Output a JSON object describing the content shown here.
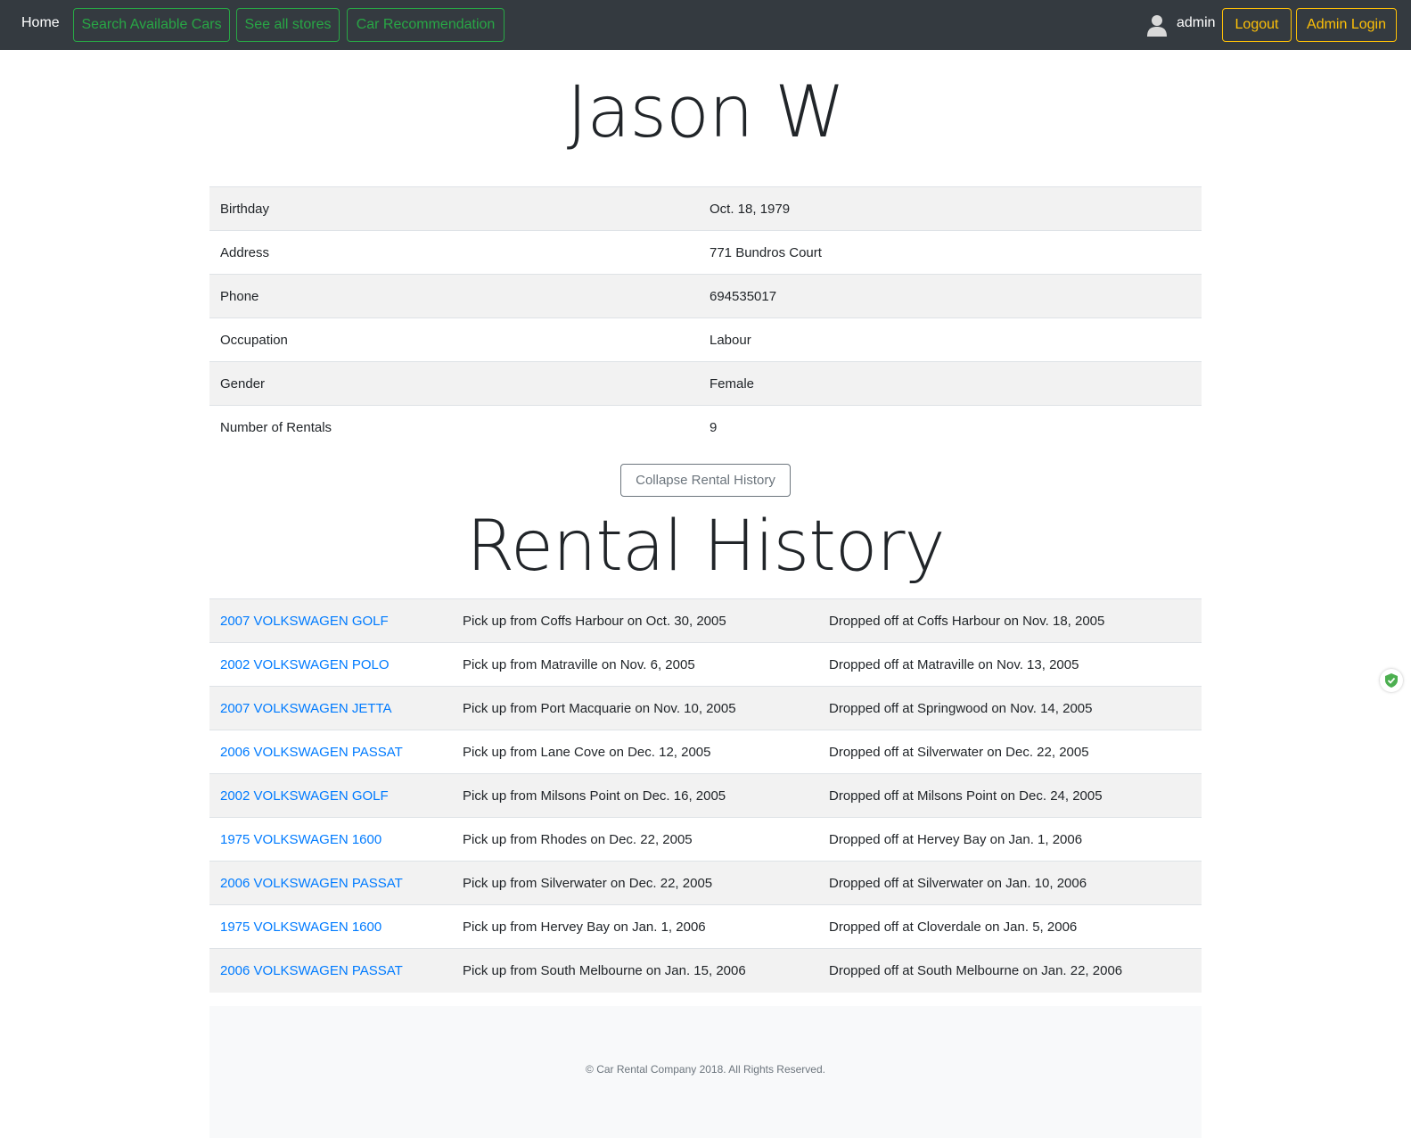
{
  "nav": {
    "home": "Home",
    "search": "Search Available Cars",
    "stores": "See all stores",
    "recommend": "Car Recommendation",
    "user": "admin",
    "logout": "Logout",
    "admin_login": "Admin Login"
  },
  "customer": {
    "name": "Jason W",
    "details": [
      {
        "label": "Birthday",
        "value": "Oct. 18, 1979"
      },
      {
        "label": "Address",
        "value": "771 Bundros Court"
      },
      {
        "label": "Phone",
        "value": "694535017"
      },
      {
        "label": "Occupation",
        "value": "Labour"
      },
      {
        "label": "Gender",
        "value": "Female"
      },
      {
        "label": "Number of Rentals",
        "value": "9"
      }
    ]
  },
  "collapse_button": "Collapse Rental History",
  "history": {
    "title": "Rental History",
    "rows": [
      {
        "car": "2007 VOLKSWAGEN GOLF",
        "pickup": "Pick up from Coffs Harbour on Oct. 30, 2005",
        "dropoff": "Dropped off at Coffs Harbour on Nov. 18, 2005"
      },
      {
        "car": "2002 VOLKSWAGEN POLO",
        "pickup": "Pick up from Matraville on Nov. 6, 2005",
        "dropoff": "Dropped off at Matraville on Nov. 13, 2005"
      },
      {
        "car": "2007 VOLKSWAGEN JETTA",
        "pickup": "Pick up from Port Macquarie on Nov. 10, 2005",
        "dropoff": "Dropped off at Springwood on Nov. 14, 2005"
      },
      {
        "car": "2006 VOLKSWAGEN PASSAT",
        "pickup": "Pick up from Lane Cove on Dec. 12, 2005",
        "dropoff": "Dropped off at Silverwater on Dec. 22, 2005"
      },
      {
        "car": "2002 VOLKSWAGEN GOLF",
        "pickup": "Pick up from Milsons Point on Dec. 16, 2005",
        "dropoff": "Dropped off at Milsons Point on Dec. 24, 2005"
      },
      {
        "car": "1975 VOLKSWAGEN 1600",
        "pickup": "Pick up from Rhodes on Dec. 22, 2005",
        "dropoff": "Dropped off at Hervey Bay on Jan. 1, 2006"
      },
      {
        "car": "2006 VOLKSWAGEN PASSAT",
        "pickup": "Pick up from Silverwater on Dec. 22, 2005",
        "dropoff": "Dropped off at Silverwater on Jan. 10, 2006"
      },
      {
        "car": "1975 VOLKSWAGEN 1600",
        "pickup": "Pick up from Hervey Bay on Jan. 1, 2006",
        "dropoff": "Dropped off at Cloverdale on Jan. 5, 2006"
      },
      {
        "car": "2006 VOLKSWAGEN PASSAT",
        "pickup": "Pick up from South Melbourne on Jan. 15, 2006",
        "dropoff": "Dropped off at South Melbourne on Jan. 22, 2006"
      }
    ]
  },
  "footer": "© Car Rental Company 2018. All Rights Reserved.",
  "icons": {
    "user": "user-icon",
    "shield": "shield-check-icon"
  },
  "colors": {
    "navbar_bg": "#343a40",
    "success": "#28a745",
    "warning": "#ffc107",
    "link": "#007bff",
    "secondary": "#6c757d",
    "striped_row": "#f2f2f2",
    "footer_bg": "#f8f9fa"
  }
}
